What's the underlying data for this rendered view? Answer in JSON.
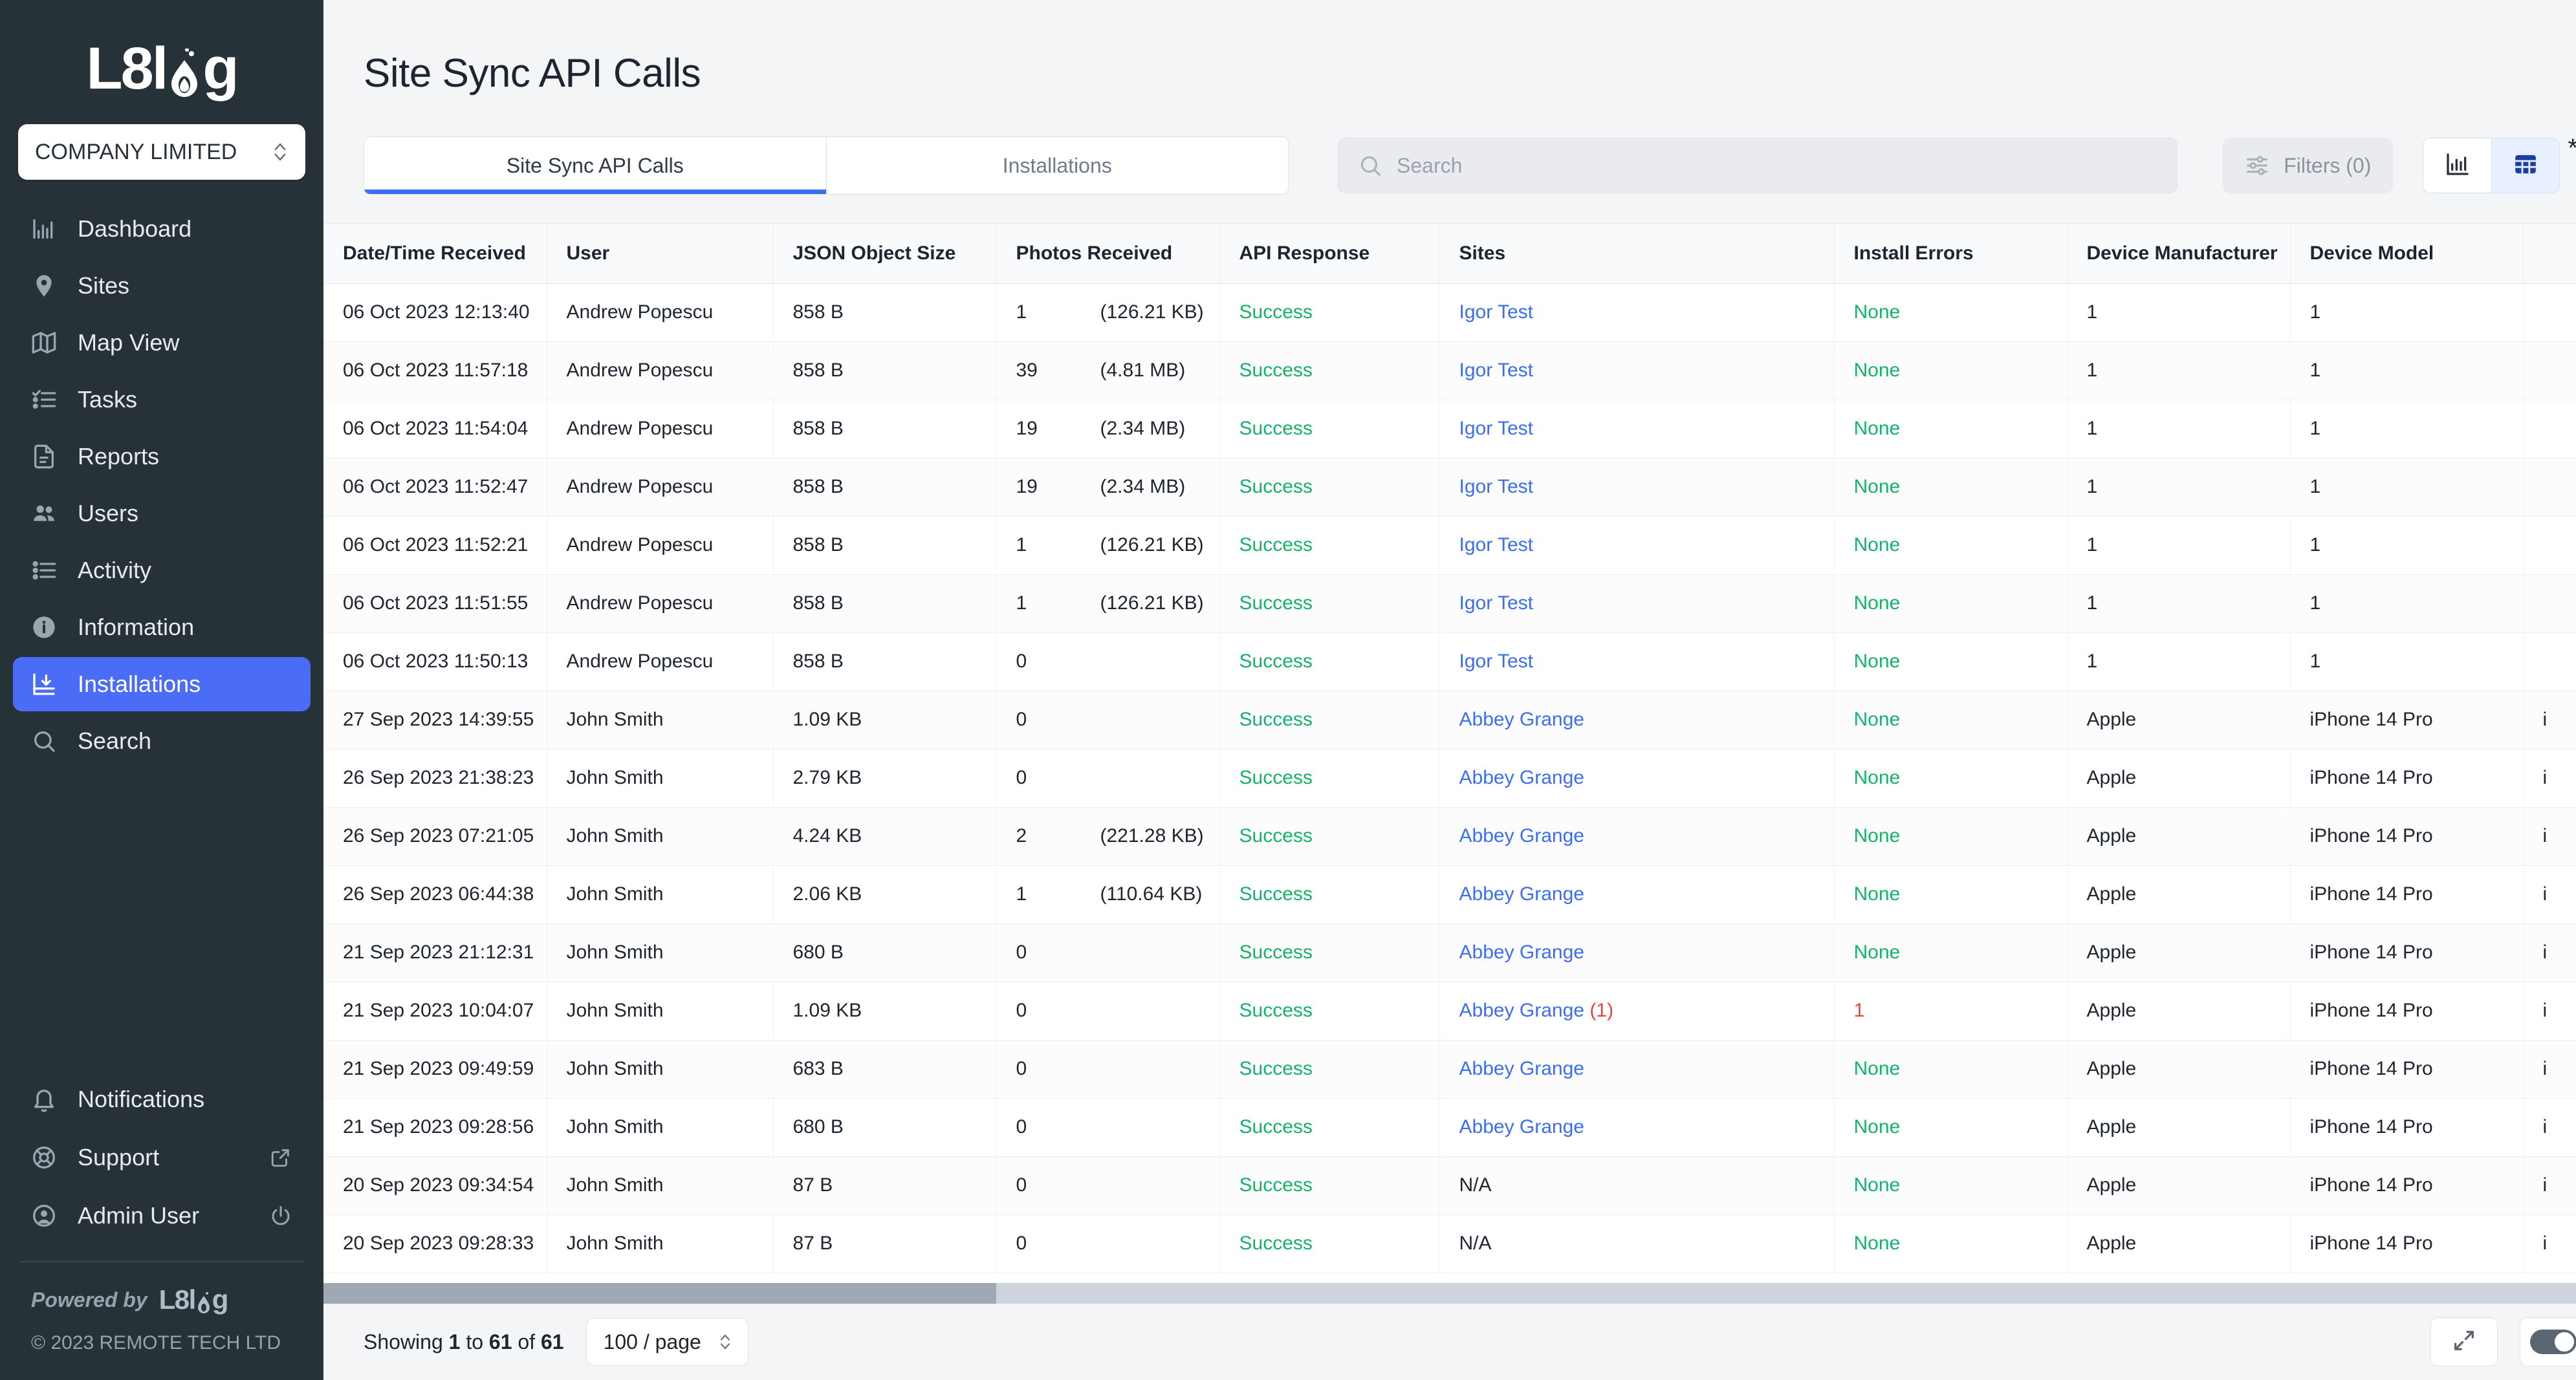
{
  "sidebar": {
    "logo_text_a": "L8l",
    "logo_text_b": "g",
    "company": {
      "label": "COMPANY LIMITED"
    },
    "items": [
      {
        "label": "Dashboard",
        "icon": "chart-bar-icon"
      },
      {
        "label": "Sites",
        "icon": "map-pin-icon"
      },
      {
        "label": "Map View",
        "icon": "map-icon"
      },
      {
        "label": "Tasks",
        "icon": "checklist-icon"
      },
      {
        "label": "Reports",
        "icon": "document-icon"
      },
      {
        "label": "Users",
        "icon": "users-icon"
      },
      {
        "label": "Activity",
        "icon": "list-icon"
      },
      {
        "label": "Information",
        "icon": "info-icon"
      },
      {
        "label": "Installations",
        "icon": "install-download-icon"
      },
      {
        "label": "Search",
        "icon": "search-icon"
      }
    ],
    "bottom_items": [
      {
        "label": "Notifications",
        "icon": "bell-icon",
        "trail": ""
      },
      {
        "label": "Support",
        "icon": "lifebuoy-icon",
        "trail": "external-link-icon"
      },
      {
        "label": "Admin User",
        "icon": "avatar-icon",
        "trail": "power-icon"
      }
    ],
    "powered_by": "Powered by",
    "powered_logo_a": "L8l",
    "powered_logo_b": "g",
    "copyright": "© 2023 REMOTE TECH LTD"
  },
  "header": {
    "title": "Site Sync API Calls"
  },
  "tabs": [
    {
      "label": "Site Sync API Calls",
      "active": true
    },
    {
      "label": "Installations",
      "active": false
    }
  ],
  "search": {
    "placeholder": "Search",
    "value": ""
  },
  "filters": {
    "label": "Filters (0)",
    "count": 0
  },
  "view_toggle": {
    "chart_label": "chart-view",
    "table_label": "table-view",
    "active": "table",
    "stars": "**"
  },
  "table": {
    "columns": [
      "Date/Time Received",
      "User",
      "JSON Object Size",
      "Photos Received",
      "API Response",
      "Sites",
      "Install Errors",
      "Device Manufacturer",
      "Device Model",
      ""
    ],
    "rows": [
      {
        "datetime": "06 Oct 2023 12:13:40",
        "user": "Andrew Popescu",
        "json_size": "858 B",
        "photos": "1",
        "photos_size": "(126.21 KB)",
        "api": "Success",
        "site": "Igor Test",
        "site_suffix": "",
        "errors": "None",
        "errors_state": "ok",
        "manufacturer": "1",
        "model": "1",
        "extra": ""
      },
      {
        "datetime": "06 Oct 2023 11:57:18",
        "user": "Andrew Popescu",
        "json_size": "858 B",
        "photos": "39",
        "photos_size": "(4.81 MB)",
        "api": "Success",
        "site": "Igor Test",
        "site_suffix": "",
        "errors": "None",
        "errors_state": "ok",
        "manufacturer": "1",
        "model": "1",
        "extra": ""
      },
      {
        "datetime": "06 Oct 2023 11:54:04",
        "user": "Andrew Popescu",
        "json_size": "858 B",
        "photos": "19",
        "photos_size": "(2.34 MB)",
        "api": "Success",
        "site": "Igor Test",
        "site_suffix": "",
        "errors": "None",
        "errors_state": "ok",
        "manufacturer": "1",
        "model": "1",
        "extra": ""
      },
      {
        "datetime": "06 Oct 2023 11:52:47",
        "user": "Andrew Popescu",
        "json_size": "858 B",
        "photos": "19",
        "photos_size": "(2.34 MB)",
        "api": "Success",
        "site": "Igor Test",
        "site_suffix": "",
        "errors": "None",
        "errors_state": "ok",
        "manufacturer": "1",
        "model": "1",
        "extra": ""
      },
      {
        "datetime": "06 Oct 2023 11:52:21",
        "user": "Andrew Popescu",
        "json_size": "858 B",
        "photos": "1",
        "photos_size": "(126.21 KB)",
        "api": "Success",
        "site": "Igor Test",
        "site_suffix": "",
        "errors": "None",
        "errors_state": "ok",
        "manufacturer": "1",
        "model": "1",
        "extra": ""
      },
      {
        "datetime": "06 Oct 2023 11:51:55",
        "user": "Andrew Popescu",
        "json_size": "858 B",
        "photos": "1",
        "photos_size": "(126.21 KB)",
        "api": "Success",
        "site": "Igor Test",
        "site_suffix": "",
        "errors": "None",
        "errors_state": "ok",
        "manufacturer": "1",
        "model": "1",
        "extra": ""
      },
      {
        "datetime": "06 Oct 2023 11:50:13",
        "user": "Andrew Popescu",
        "json_size": "858 B",
        "photos": "0",
        "photos_size": "",
        "api": "Success",
        "site": "Igor Test",
        "site_suffix": "",
        "errors": "None",
        "errors_state": "ok",
        "manufacturer": "1",
        "model": "1",
        "extra": ""
      },
      {
        "datetime": "27 Sep 2023 14:39:55",
        "user": "John Smith",
        "json_size": "1.09 KB",
        "photos": "0",
        "photos_size": "",
        "api": "Success",
        "site": "Abbey Grange",
        "site_suffix": "",
        "errors": "None",
        "errors_state": "ok",
        "manufacturer": "Apple",
        "model": "iPhone 14 Pro",
        "extra": "i"
      },
      {
        "datetime": "26 Sep 2023 21:38:23",
        "user": "John Smith",
        "json_size": "2.79 KB",
        "photos": "0",
        "photos_size": "",
        "api": "Success",
        "site": "Abbey Grange",
        "site_suffix": "",
        "errors": "None",
        "errors_state": "ok",
        "manufacturer": "Apple",
        "model": "iPhone 14 Pro",
        "extra": "i"
      },
      {
        "datetime": "26 Sep 2023 07:21:05",
        "user": "John Smith",
        "json_size": "4.24 KB",
        "photos": "2",
        "photos_size": "(221.28 KB)",
        "api": "Success",
        "site": "Abbey Grange",
        "site_suffix": "",
        "errors": "None",
        "errors_state": "ok",
        "manufacturer": "Apple",
        "model": "iPhone 14 Pro",
        "extra": "i"
      },
      {
        "datetime": "26 Sep 2023 06:44:38",
        "user": "John Smith",
        "json_size": "2.06 KB",
        "photos": "1",
        "photos_size": "(110.64 KB)",
        "api": "Success",
        "site": "Abbey Grange",
        "site_suffix": "",
        "errors": "None",
        "errors_state": "ok",
        "manufacturer": "Apple",
        "model": "iPhone 14 Pro",
        "extra": "i"
      },
      {
        "datetime": "21 Sep 2023 21:12:31",
        "user": "John Smith",
        "json_size": "680 B",
        "photos": "0",
        "photos_size": "",
        "api": "Success",
        "site": "Abbey Grange",
        "site_suffix": "",
        "errors": "None",
        "errors_state": "ok",
        "manufacturer": "Apple",
        "model": "iPhone 14 Pro",
        "extra": "i"
      },
      {
        "datetime": "21 Sep 2023 10:04:07",
        "user": "John Smith",
        "json_size": "1.09 KB",
        "photos": "0",
        "photos_size": "",
        "api": "Success",
        "site": "Abbey Grange",
        "site_suffix": "(1)",
        "errors": "1",
        "errors_state": "err",
        "manufacturer": "Apple",
        "model": "iPhone 14 Pro",
        "extra": "i"
      },
      {
        "datetime": "21 Sep 2023 09:49:59",
        "user": "John Smith",
        "json_size": "683 B",
        "photos": "0",
        "photos_size": "",
        "api": "Success",
        "site": "Abbey Grange",
        "site_suffix": "",
        "errors": "None",
        "errors_state": "ok",
        "manufacturer": "Apple",
        "model": "iPhone 14 Pro",
        "extra": "i"
      },
      {
        "datetime": "21 Sep 2023 09:28:56",
        "user": "John Smith",
        "json_size": "680 B",
        "photos": "0",
        "photos_size": "",
        "api": "Success",
        "site": "Abbey Grange",
        "site_suffix": "",
        "errors": "None",
        "errors_state": "ok",
        "manufacturer": "Apple",
        "model": "iPhone 14 Pro",
        "extra": "i"
      },
      {
        "datetime": "20 Sep 2023 09:34:54",
        "user": "John Smith",
        "json_size": "87 B",
        "photos": "0",
        "photos_size": "",
        "api": "Success",
        "site": "N/A",
        "site_suffix": "",
        "errors": "None",
        "errors_state": "ok",
        "manufacturer": "Apple",
        "model": "iPhone 14 Pro",
        "extra": "i"
      },
      {
        "datetime": "20 Sep 2023 09:28:33",
        "user": "John Smith",
        "json_size": "87 B",
        "photos": "0",
        "photos_size": "",
        "api": "Success",
        "site": "N/A",
        "site_suffix": "",
        "errors": "None",
        "errors_state": "ok",
        "manufacturer": "Apple",
        "model": "iPhone 14 Pro",
        "extra": "i"
      }
    ]
  },
  "footer": {
    "showing_prefix": "Showing ",
    "showing_from": "1",
    "showing_mid": " to ",
    "showing_to": "61",
    "showing_suffix": " of ",
    "showing_total": "61",
    "per_page": "100 / page",
    "expand_label": "expand-view",
    "toggle_label": "density-toggle"
  },
  "colors": {
    "sidebar_bg": "#263238",
    "accent_blue": "#4a6cf7",
    "link_blue": "#3b6ef0",
    "success_green": "#17b26a",
    "error_red": "#e8443a"
  }
}
